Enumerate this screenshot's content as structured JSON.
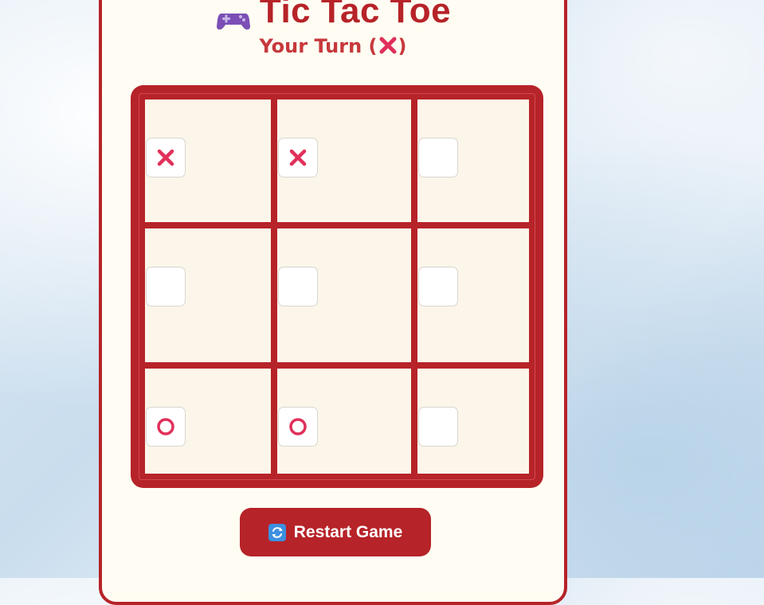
{
  "game": {
    "title": "Tic Tac Toe",
    "title_icon": "game-controller-icon",
    "turn_label": "Your Turn (",
    "turn_label_close": ")",
    "turn_mark": "X",
    "restart_label": "Restart Game",
    "restart_icon": "refresh-icon",
    "board": [
      [
        "X",
        "X",
        ""
      ],
      [
        "",
        "",
        ""
      ],
      [
        "O",
        "O",
        ""
      ]
    ]
  },
  "colors": {
    "accent": "#b62328",
    "card_bg": "#fffdf3",
    "cell_bg": "#fcf6ea",
    "x_mark": "#e0305a",
    "o_mark": "#e0305a",
    "turn_text": "#c7383c"
  }
}
